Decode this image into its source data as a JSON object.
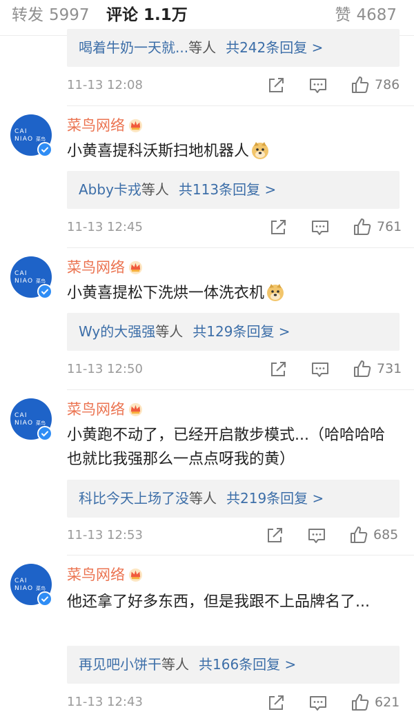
{
  "tabs": {
    "repost_label": "转发",
    "repost_count": "5997",
    "comment_label": "评论",
    "comment_count": "1.1万",
    "like_label": "赞",
    "like_count": "4687"
  },
  "colors": {
    "accent_orange": "#ff8200",
    "username": "#eb7350",
    "link_blue": "#3c6ea8",
    "avatar_blue": "#1e63c8"
  },
  "avatar_logo_lines": [
    "CAI",
    "NIAO",
    "菜鸟"
  ],
  "icons": {
    "vip": "vip-crown-icon",
    "verified": "verified-check-icon",
    "share": "share-icon",
    "reply": "reply-bubble-icon",
    "like": "thumb-up-icon",
    "emoji": "doge-emoji-icon"
  },
  "comments": [
    {
      "reply": {
        "users": "喝着牛奶一天就...",
        "mid": "等人",
        "count": "共242条回复 >"
      },
      "time": "11-13 12:08",
      "likes": "786"
    },
    {
      "name": "菜鸟网络",
      "text": "小黄喜提科沃斯扫地机器人",
      "reply": {
        "users": "Abby卡戎",
        "mid": "等人",
        "count": "共113条回复 >"
      },
      "time": "11-13 12:45",
      "likes": "761"
    },
    {
      "name": "菜鸟网络",
      "text": "小黄喜提松下洗烘一体洗衣机",
      "reply": {
        "users": "Wy的大强强",
        "mid": "等人",
        "count": "共129条回复 >"
      },
      "time": "11-13 12:50",
      "likes": "731"
    },
    {
      "name": "菜鸟网络",
      "text": "小黄跑不动了，已经开启散步模式...（哈哈哈哈也就比我强那么一点点呀我的黄）",
      "reply": {
        "users": "科比今天上场了没",
        "mid": "等人",
        "count": "共219条回复 >"
      },
      "time": "11-13 12:53",
      "likes": "685"
    },
    {
      "name": "菜鸟网络",
      "text": "他还拿了好多东西，但是我跟不上品牌名了...",
      "reply": {
        "users": "再见吧小饼干",
        "mid": "等人",
        "count": "共166条回复 >"
      },
      "time": "11-13 12:43",
      "likes": "621"
    }
  ]
}
